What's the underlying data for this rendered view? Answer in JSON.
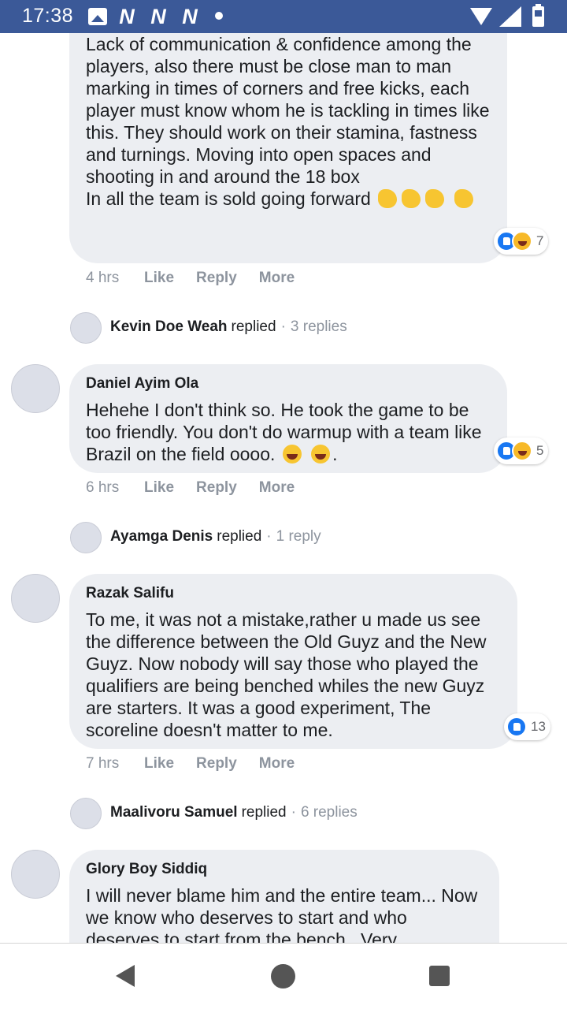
{
  "status_bar": {
    "time": "17:38",
    "n_icons": [
      "N",
      "N",
      "N"
    ]
  },
  "comments": [
    {
      "author": "",
      "text": "Lack of communication & confidence among the players, also there must be close man to man marking in times of corners and free kicks, each player must know whom he is tackling in times like this. They should work on their stamina, fastness and turnings. Moving into open spaces and shooting in and around the 18 box\nIn all the team is sold going forward",
      "reaction_count": "7",
      "time": "4 hrs",
      "like": "Like",
      "reply": "Reply",
      "more": "More",
      "replied_name": "Kevin Doe Weah",
      "replied_verb": "replied",
      "replied_count": "3 replies"
    },
    {
      "author": "Daniel Ayim Ola",
      "text": "Hehehe I don't think so. He took the game to be too friendly. You don't do warmup with a team like Brazil on the field oooo.",
      "text_end": ".",
      "reaction_count": "5",
      "time": "6 hrs",
      "like": "Like",
      "reply": "Reply",
      "more": "More",
      "replied_name": "Ayamga Denis",
      "replied_verb": "replied",
      "replied_count": "1 reply"
    },
    {
      "author": "Razak Salifu",
      "text": "To me, it was not a mistake,rather u made us see the difference between the Old Guyz and the New Guyz. Now nobody will say those who played the qualifiers are being benched whiles the new Guyz are starters. It was a good experiment, The scoreline doesn't matter to me.",
      "reaction_count": "13",
      "time": "7 hrs",
      "like": "Like",
      "reply": "Reply",
      "more": "More",
      "replied_name": "Maalivoru Samuel",
      "replied_verb": "replied",
      "replied_count": "6 replies"
    },
    {
      "author": "Glory Boy Siddiq",
      "text": "I will never blame him and the entire team... Now we know who deserves to start and who deserves to start from the bench...Very"
    }
  ],
  "colors": {
    "status_bar": "#3b5998",
    "bubble": "#eceef2",
    "like_blue": "#1877f2"
  }
}
